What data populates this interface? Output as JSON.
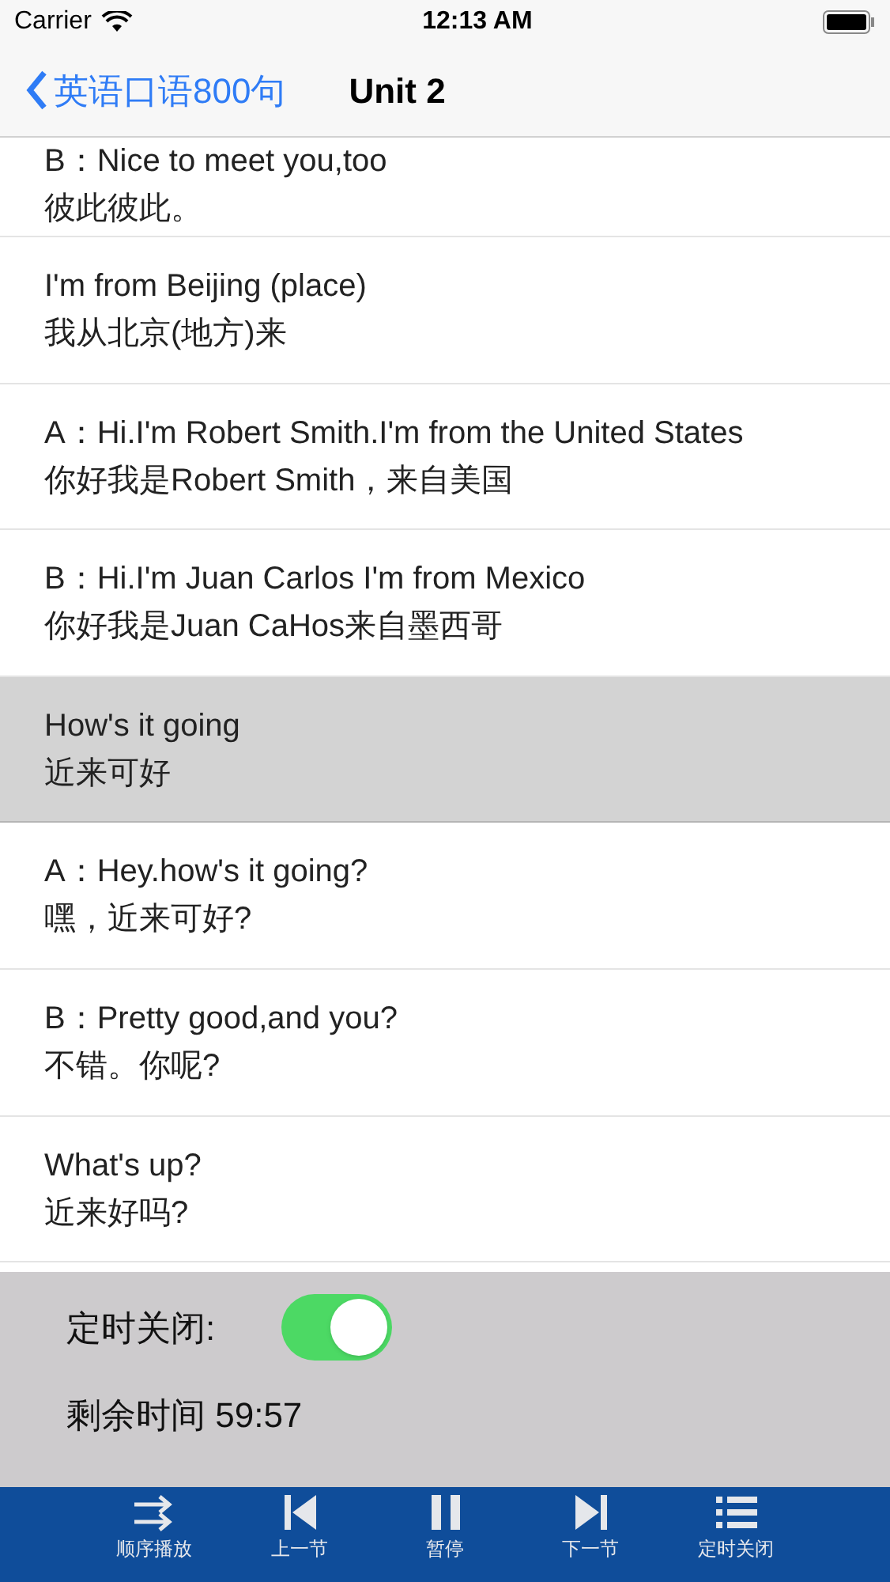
{
  "status_bar": {
    "carrier": "Carrier",
    "time": "12:13 AM"
  },
  "nav": {
    "back": "英语口语800句",
    "title": "Unit 2"
  },
  "rows": [
    {
      "english": "B：Nice to meet you,too",
      "chinese": "彼此彼此。",
      "selected": false
    },
    {
      "english": "I'm from Beijing (place)",
      "chinese": "我从北京(地方)来",
      "selected": false
    },
    {
      "english": "A：Hi.I'm Robert Smith.I'm from the United States",
      "chinese": "你好我是Robert Smith，来自美国",
      "selected": false
    },
    {
      "english": "B：Hi.I'm Juan Carlos I'm from Mexico",
      "chinese": "你好我是Juan CaHos来自墨西哥",
      "selected": false
    },
    {
      "english": "How's it going",
      "chinese": "近来可好",
      "selected": true
    },
    {
      "english": "A：Hey.how's it going?",
      "chinese": "嘿，近来可好?",
      "selected": false
    },
    {
      "english": "B：Pretty good,and you?",
      "chinese": "不错。你呢?",
      "selected": false
    },
    {
      "english": "What's up?",
      "chinese": "近来好吗?",
      "selected": false
    }
  ],
  "timer": {
    "label": "定时关闭:",
    "on": true,
    "remaining": "剩余时间 59:57"
  },
  "toolbar": [
    {
      "kind": "order",
      "label": "顺序播放"
    },
    {
      "kind": "prev",
      "label": "上一节"
    },
    {
      "kind": "pause",
      "label": "暂停"
    },
    {
      "kind": "next",
      "label": "下一节"
    },
    {
      "kind": "timer",
      "label": "定时关闭"
    }
  ]
}
